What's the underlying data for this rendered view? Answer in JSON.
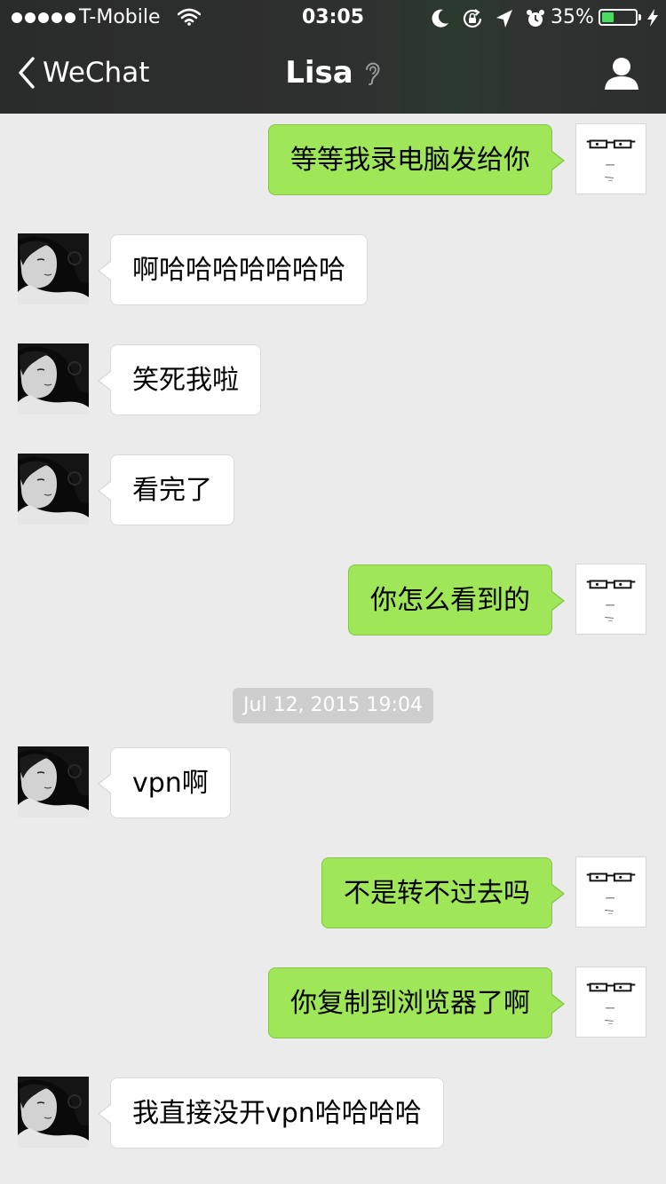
{
  "status_bar": {
    "carrier": "T-Mobile",
    "time": "03:05",
    "battery_percent": "35%",
    "battery_level": 0.35,
    "icons": [
      "signal-dots-icon",
      "wifi-icon",
      "moon-icon",
      "rotation-lock-icon",
      "location-arrow-icon",
      "alarm-clock-icon",
      "battery-icon",
      "charging-bolt-icon"
    ]
  },
  "nav": {
    "back_label": "WeChat",
    "title": "Lisa",
    "icons": [
      "back-chevron-icon",
      "earpiece-mode-icon",
      "contact-profile-icon"
    ]
  },
  "colors": {
    "sent_bubble": "#9fe658",
    "received_bubble": "#ffffff",
    "chat_background": "#ebebeb",
    "header": "#2f3030"
  },
  "messages": [
    {
      "sender": "me",
      "text": "等等我录电脑发给你"
    },
    {
      "sender": "Lisa",
      "text": "啊哈哈哈哈哈哈哈"
    },
    {
      "sender": "Lisa",
      "text": "笑死我啦"
    },
    {
      "sender": "Lisa",
      "text": "看完了"
    },
    {
      "sender": "me",
      "text": "你怎么看到的"
    },
    {
      "sender": "Lisa",
      "text": "vpn啊"
    },
    {
      "sender": "me",
      "text": "不是转不过去吗"
    },
    {
      "sender": "me",
      "text": "你复制到浏览器了啊"
    },
    {
      "sender": "Lisa",
      "text": "我直接没开vpn哈哈哈哈"
    }
  ],
  "timestamp": "Jul 12, 2015 19:04"
}
